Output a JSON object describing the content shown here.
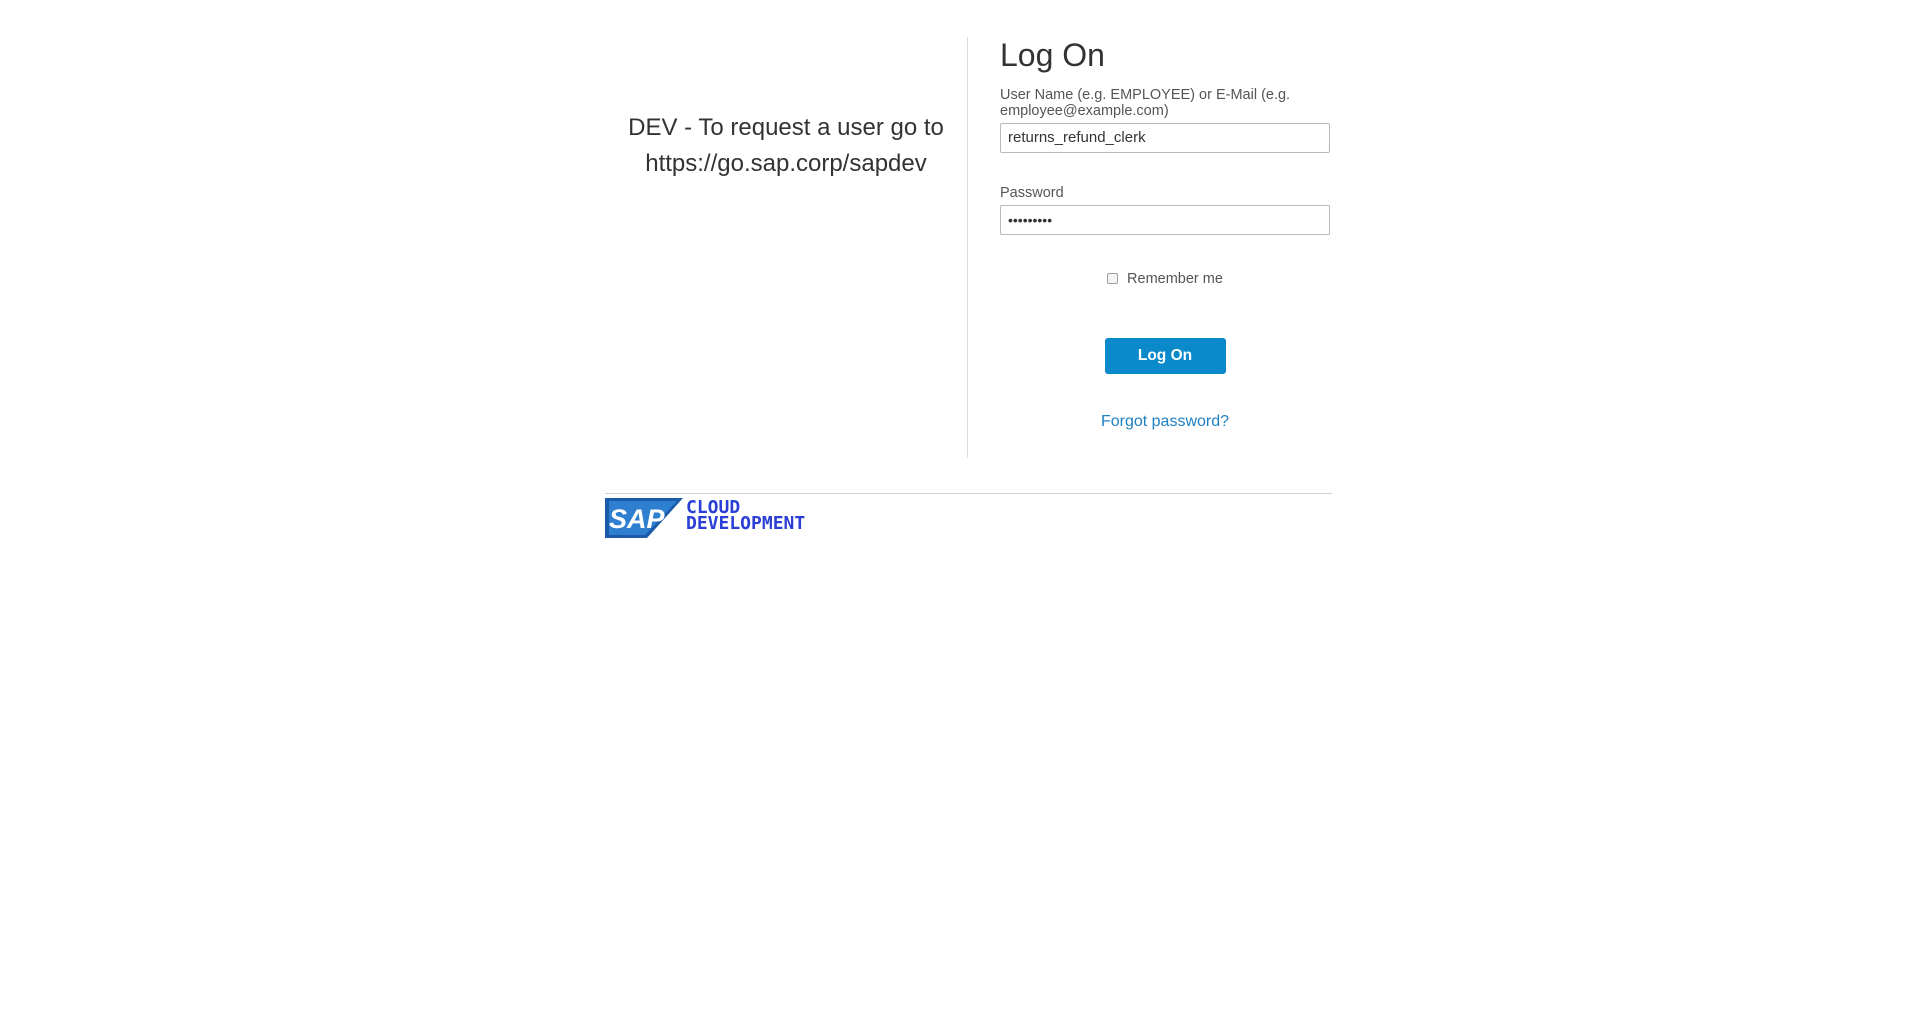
{
  "info": {
    "line1": "DEV - To request a user go to",
    "line2": "https://go.sap.corp/sapdev"
  },
  "form": {
    "title": "Log On",
    "username_label": "User Name (e.g. EMPLOYEE) or E-Mail (e.g. employee@example.com)",
    "username_value": "returns_refund_clerk",
    "password_label": "Password",
    "password_value": "•••••••••",
    "remember_label": "Remember me",
    "remember_checked": false,
    "logon_button": "Log On",
    "forgot_link": "Forgot password?"
  },
  "footer": {
    "logo_brand": "SAP",
    "logo_line1": "CLOUD",
    "logo_line2": "DEVELOPMENT"
  },
  "colors": {
    "primary_button": "#0a8acb",
    "link": "#1e7fc2",
    "logo_blue": "#2b3fd6"
  }
}
